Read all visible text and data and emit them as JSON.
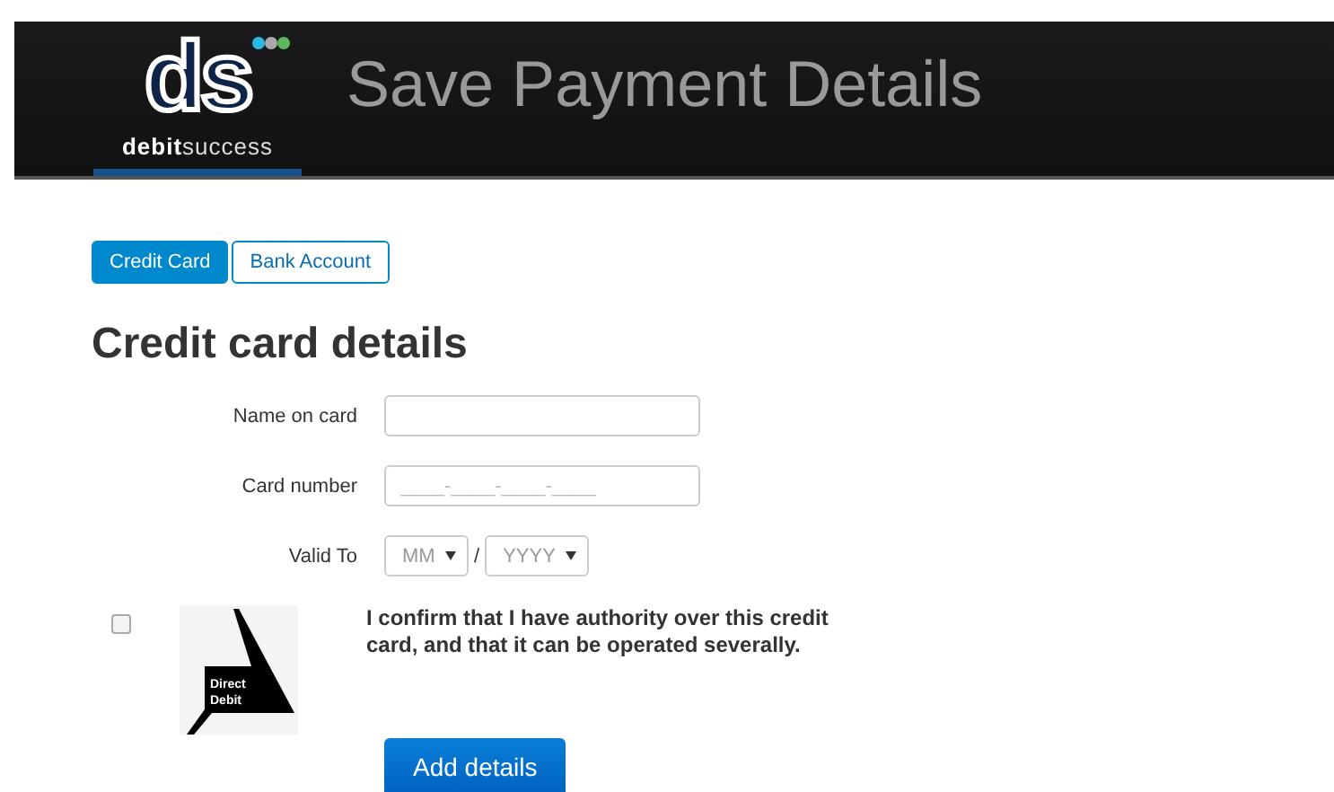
{
  "header": {
    "logo_mark": "ds",
    "logo_word_bold": "debit",
    "logo_word_light": "success",
    "title": "Save Payment Details"
  },
  "tabs": [
    {
      "label": "Credit Card",
      "selected": true
    },
    {
      "label": "Bank Account",
      "selected": false
    }
  ],
  "heading": "Credit card details",
  "fields": [
    {
      "kind": "text",
      "label": "Name on card"
    },
    {
      "kind": "text",
      "label": "Card number",
      "value": "____-____-____-____"
    },
    {
      "kind": "expiry",
      "label": "Valid To",
      "month": "MM",
      "separator": "/",
      "year": "YYYY"
    }
  ],
  "confirm": {
    "checked": false,
    "badge_line1": "Direct",
    "badge_line2": "Debit",
    "text": "I confirm that I have authority over this credit card, and that it can be operated severally."
  },
  "submit": "Add details"
}
